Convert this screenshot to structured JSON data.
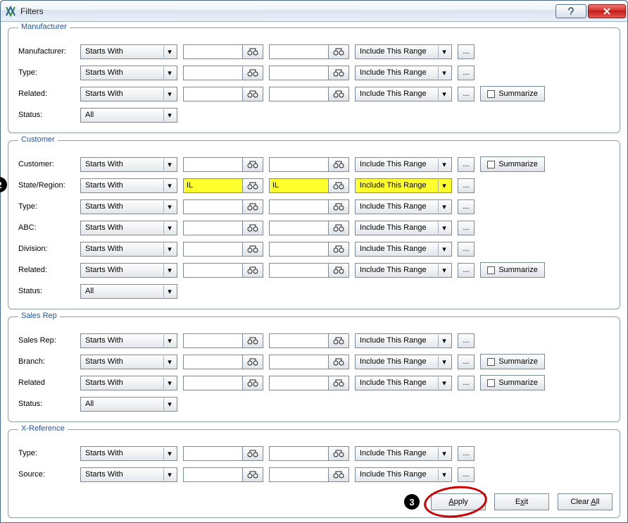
{
  "window": {
    "title": "Filters"
  },
  "callouts": {
    "c2": "2",
    "c3": "3"
  },
  "buttons": {
    "apply": "Apply",
    "exit": "Exit",
    "clear": "Clear All",
    "summarize": "Summarize",
    "ellipsis": "..."
  },
  "selectOptions": {
    "startsWith": "Starts With",
    "includeRange": "Include This Range",
    "all": "All"
  },
  "groups": {
    "manufacturer": {
      "legend": "Manufacturer",
      "rows": {
        "manufacturer": {
          "label": "Manufacturer:",
          "mode": "Starts With",
          "range": "Include This Range"
        },
        "type": {
          "label": "Type:",
          "mode": "Starts With",
          "range": "Include This Range"
        },
        "related": {
          "label": "Related:",
          "mode": "Starts With",
          "range": "Include This Range"
        },
        "status": {
          "label": "Status:",
          "mode": "All"
        }
      }
    },
    "customer": {
      "legend": "Customer",
      "rows": {
        "customer": {
          "label": "Customer:",
          "mode": "Starts With",
          "range": "Include This Range"
        },
        "stateRegion": {
          "label": "State/Region:",
          "mode": "Starts With",
          "range": "Include This Range",
          "from": "IL",
          "to": "IL"
        },
        "type": {
          "label": "Type:",
          "mode": "Starts With",
          "range": "Include This Range"
        },
        "abc": {
          "label": "ABC:",
          "mode": "Starts With",
          "range": "Include This Range"
        },
        "division": {
          "label": "Division:",
          "mode": "Starts With",
          "range": "Include This Range"
        },
        "related": {
          "label": "Related:",
          "mode": "Starts With",
          "range": "Include This Range"
        },
        "status": {
          "label": "Status:",
          "mode": "All"
        }
      }
    },
    "salesRep": {
      "legend": "Sales Rep",
      "rows": {
        "salesRep": {
          "label": "Sales Rep:",
          "mode": "Starts With",
          "range": "Include This Range"
        },
        "branch": {
          "label": "Branch:",
          "mode": "Starts With",
          "range": "Include This Range"
        },
        "related": {
          "label": "Related",
          "mode": "Starts With",
          "range": "Include This Range"
        },
        "status": {
          "label": "Status:",
          "mode": "All"
        }
      }
    },
    "xref": {
      "legend": "X-Reference",
      "rows": {
        "type": {
          "label": "Type:",
          "mode": "Starts With",
          "range": "Include This Range"
        },
        "source": {
          "label": "Source:",
          "mode": "Starts With",
          "range": "Include This Range"
        }
      }
    }
  }
}
